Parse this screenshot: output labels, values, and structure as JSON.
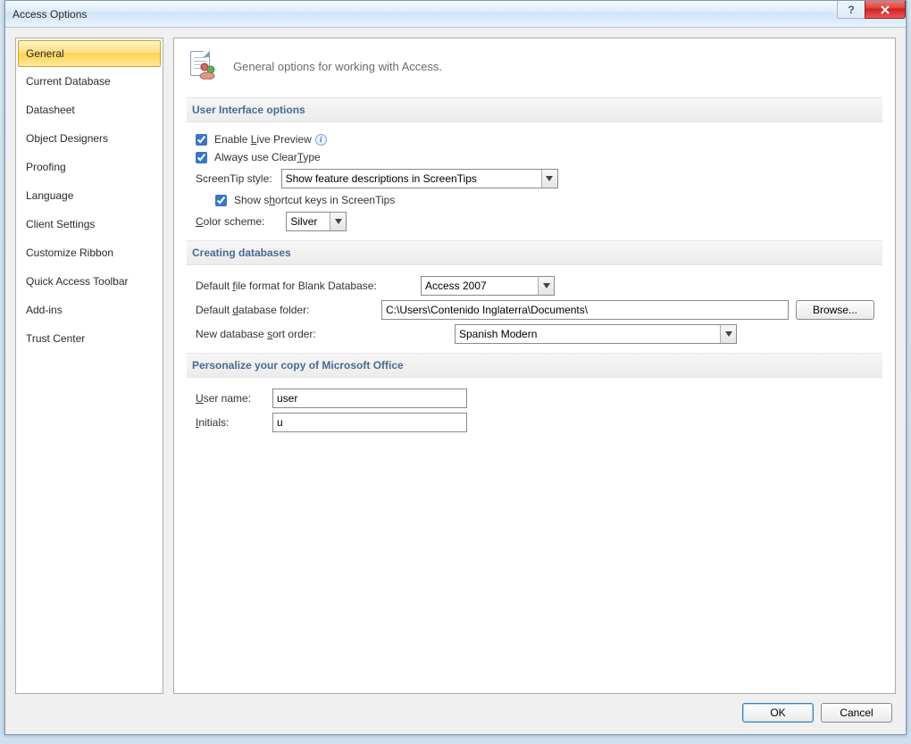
{
  "window": {
    "title": "Access Options"
  },
  "sidebar": {
    "items": [
      {
        "label": "General",
        "selected": true
      },
      {
        "label": "Current Database"
      },
      {
        "label": "Datasheet"
      },
      {
        "label": "Object Designers"
      },
      {
        "label": "Proofing"
      },
      {
        "label": "Language"
      },
      {
        "label": "Client Settings"
      },
      {
        "label": "Customize Ribbon"
      },
      {
        "label": "Quick Access Toolbar"
      },
      {
        "label": "Add-ins"
      },
      {
        "label": "Trust Center"
      }
    ]
  },
  "header": {
    "text": "General options for working with Access."
  },
  "ui_section_title": "User Interface options",
  "ui": {
    "enable_live_preview_pre": "Enable ",
    "enable_live_preview_u": "L",
    "enable_live_preview_post": "ive Preview",
    "always_cleartype_pre": "Always use Clear",
    "always_cleartype_u": "T",
    "always_cleartype_post": "ype",
    "screentip_style_label": "ScreenTip style:",
    "screentip_style_value": "Show feature descriptions in ScreenTips",
    "show_shortcut_pre": "Show s",
    "show_shortcut_u": "h",
    "show_shortcut_post": "ortcut keys in ScreenTips",
    "color_scheme_u": "C",
    "color_scheme_post": "olor scheme:",
    "color_scheme_value": "Silver"
  },
  "db_section_title": "Creating databases",
  "db": {
    "default_fmt_pre": "Default ",
    "default_fmt_u": "f",
    "default_fmt_post": "ile format for Blank Database:",
    "default_fmt_value": "Access 2007",
    "default_folder_pre": "Default ",
    "default_folder_u": "d",
    "default_folder_post": "atabase folder:",
    "default_folder_value": "C:\\Users\\Contenido Inglaterra\\Documents\\",
    "browse_label": "Browse...",
    "sort_order_pre": "New database ",
    "sort_order_u": "s",
    "sort_order_post": "ort order:",
    "sort_order_value": "Spanish Modern"
  },
  "personalize_section_title": "Personalize your copy of Microsoft Office",
  "pers": {
    "username_u": "U",
    "username_post": "ser name:",
    "username_value": "user",
    "initials_u": "I",
    "initials_post": "nitials:",
    "initials_value": "u"
  },
  "footer": {
    "ok": "OK",
    "cancel": "Cancel"
  }
}
